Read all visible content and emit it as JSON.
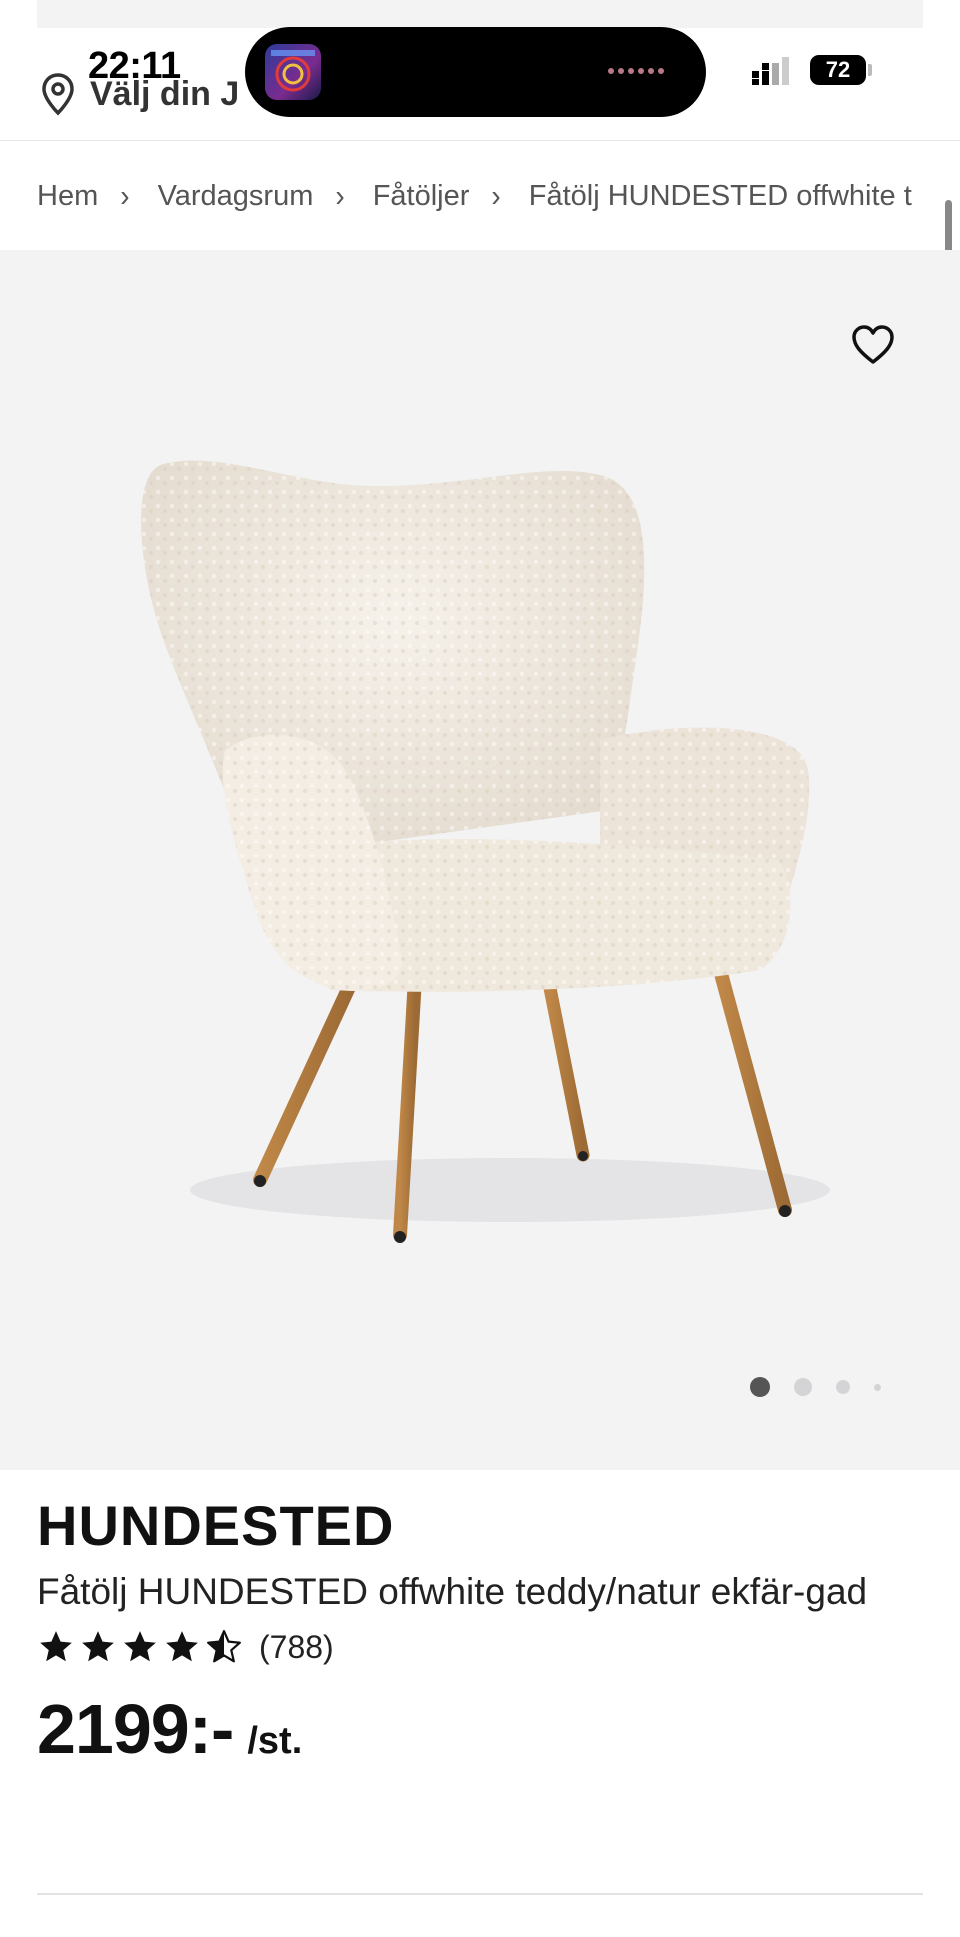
{
  "status_bar": {
    "time": "22:11",
    "battery": "72"
  },
  "header": {
    "store_label": "Välj din J"
  },
  "breadcrumb": {
    "items": [
      "Hem",
      "Vardagsrum",
      "Fåtöljer",
      "Fåtölj HUNDESTED offwhite t"
    ],
    "separator": "›"
  },
  "gallery": {
    "image_alt_icon": "armchair-image",
    "favorite_icon": "heart-icon",
    "active_index": 0,
    "total_images": 4
  },
  "product": {
    "brand": "HUNDESTED",
    "name": "Fåtölj HUNDESTED offwhite teddy/natur ekfär-gad",
    "rating": 4.5,
    "review_count": "(788)",
    "price": "2199:-",
    "unit": "/st."
  },
  "colors": {
    "gallery_bg": "#f3f3f4",
    "text": "#111111",
    "breadcrumb_text": "#555555"
  }
}
